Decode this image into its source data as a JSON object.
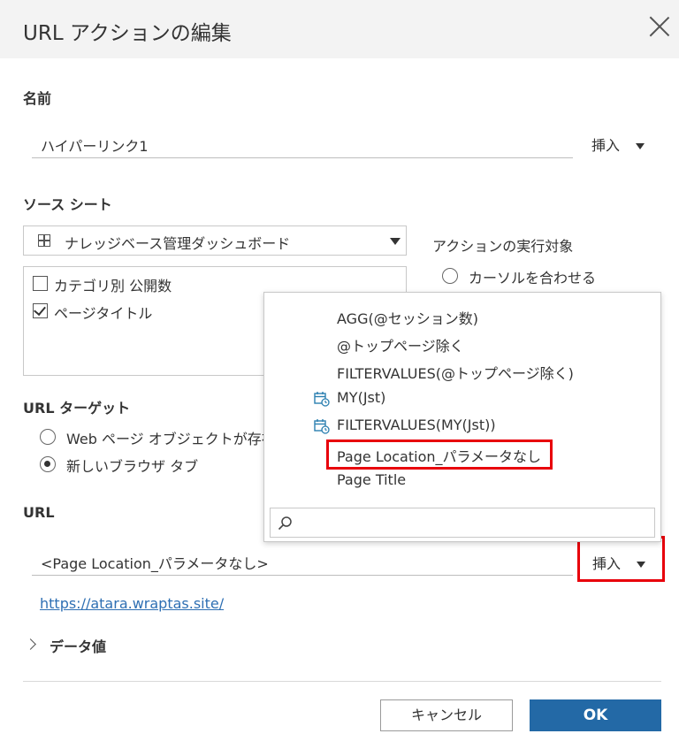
{
  "dialog": {
    "title": "URL アクションの編集"
  },
  "name_section": {
    "label": "名前",
    "value": "ハイパーリンク1",
    "insert_label": "挿入"
  },
  "source_sheet": {
    "label": "ソース シート",
    "selected": "ナレッジベース管理ダッシュボード",
    "sheets": [
      {
        "label": "カテゴリ別 公開数",
        "checked": false
      },
      {
        "label": "ページタイトル",
        "checked": true
      }
    ]
  },
  "run_action_on": {
    "label": "アクションの実行対象",
    "option_hover": "カーソルを合わせる"
  },
  "url_target": {
    "label": "URL ターゲット",
    "options": [
      {
        "label": "Web ページ オブジェクトが存在",
        "selected": false
      },
      {
        "label": "新しいブラウザ タブ",
        "selected": true
      }
    ]
  },
  "url_section": {
    "label": "URL",
    "value": "<Page Location_パラメータなし>",
    "insert_label": "挿入",
    "link": "https://atara.wraptas.site/"
  },
  "insert_menu": {
    "items": [
      {
        "label": "AGG(@セッション数)",
        "icon": ""
      },
      {
        "label": "@トップページ除く",
        "icon": ""
      },
      {
        "label": "FILTERVALUES(@トップページ除く)",
        "icon": ""
      },
      {
        "label": "MY(Jst)",
        "icon": "calendar-clock-icon"
      },
      {
        "label": "FILTERVALUES(MY(Jst))",
        "icon": "calendar-clock-icon"
      },
      {
        "label": "Page Location_パラメータなし",
        "icon": ""
      },
      {
        "label": "Page Title",
        "icon": ""
      }
    ],
    "search_placeholder": ""
  },
  "data_values": {
    "label": "データ値"
  },
  "footer": {
    "cancel_label": "キャンセル",
    "ok_label": "OK"
  },
  "colors": {
    "ok_button": "#2369a6",
    "highlight": "#e8000b",
    "link": "#2e6fb3",
    "icon_teal": "#2b7fb0"
  }
}
